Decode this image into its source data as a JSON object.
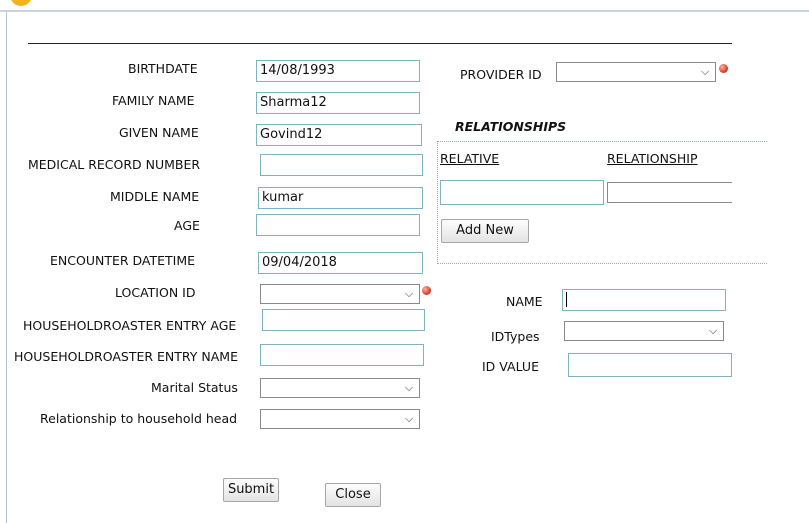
{
  "form": {
    "labels": {
      "birthdate": "BIRTHDATE",
      "family_name": "FAMILY NAME",
      "given_name": "GIVEN NAME",
      "mrn": "MEDICAL RECORD NUMBER",
      "middle_name": "MIDDLE NAME",
      "age": "AGE",
      "encounter": "ENCOUNTER DATETIME",
      "location": "LOCATION ID",
      "hh_age": "HOUSEHOLDROASTER ENTRY AGE",
      "hh_name": "HOUSEHOLDROASTER ENTRY NAME",
      "marital": "Marital Status",
      "relationship_head": "Relationship to household head",
      "provider": "PROVIDER ID",
      "name": "NAME",
      "idtypes": "IDTypes",
      "idvalue": "ID VALUE"
    },
    "values": {
      "birthdate": "14/08/1993",
      "family_name": "Sharma12",
      "given_name": "Govind12",
      "mrn": "",
      "middle_name": "kumar",
      "age": "",
      "encounter": "09/04/2018",
      "hh_age": "",
      "hh_name": "",
      "name": "",
      "idvalue": ""
    },
    "selects": {
      "location": "",
      "marital": "",
      "relationship_head": "",
      "provider": "",
      "idtypes": ""
    }
  },
  "relationships": {
    "title": "RELATIONSHIPS",
    "col_relative": "RELATIVE",
    "col_relationship": "RELATIONSHIP",
    "add_label": "Add New",
    "relative_value": "",
    "relationship_value": ""
  },
  "actions": {
    "submit_label": "Submit",
    "close_label": "Close"
  },
  "icons": {
    "dropdown": "chevron-down-icon",
    "required": "required-dot-icon"
  },
  "colors": {
    "input_border": "#7fb3c2",
    "required_dot": "#e0402a",
    "accent_icon": "#f2b21b"
  }
}
